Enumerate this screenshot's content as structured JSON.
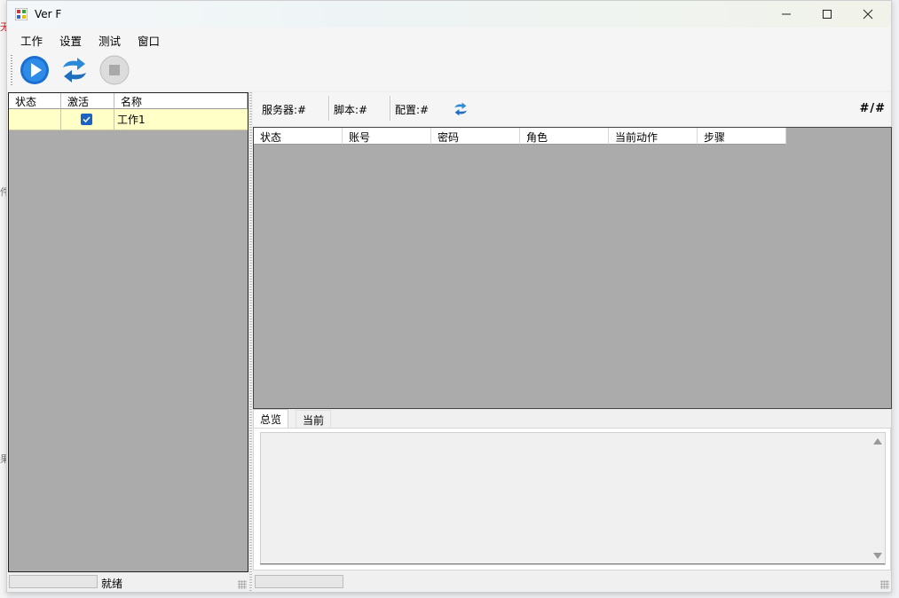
{
  "background": {
    "glyphs": [
      "无",
      "件",
      "果"
    ]
  },
  "window": {
    "title": "Ver F",
    "controls": [
      "minimize-icon",
      "maximize-icon",
      "close-icon"
    ]
  },
  "menu": {
    "items": [
      "工作",
      "设置",
      "测试",
      "窗口"
    ]
  },
  "toolbar": {
    "buttons": [
      {
        "icon": "play-icon",
        "color": "#1a6fd1"
      },
      {
        "icon": "refresh-icon",
        "color": "#2a8ad8"
      },
      {
        "icon": "stop-icon",
        "color": "#aaaaaa",
        "enabled": false
      }
    ]
  },
  "left_grid": {
    "columns": [
      "状态",
      "激活",
      "名称"
    ],
    "rows": [
      {
        "status": "",
        "active": true,
        "name": "工作1"
      }
    ],
    "row_highlight": "#ffffc8"
  },
  "left_status": {
    "progress": 0,
    "text": "就绪"
  },
  "info_bar": {
    "server_label": "服务器:#",
    "script_label": "脚本:#",
    "config_label": "配置:#",
    "ratio": "#/#"
  },
  "account_grid": {
    "columns": [
      "状态",
      "账号",
      "密码",
      "角色",
      "当前动作",
      "步骤"
    ]
  },
  "tabs": {
    "items": [
      "总览",
      "当前"
    ],
    "active": 0
  },
  "overview_log": {
    "text": ""
  },
  "right_status": {
    "progress": 0
  }
}
